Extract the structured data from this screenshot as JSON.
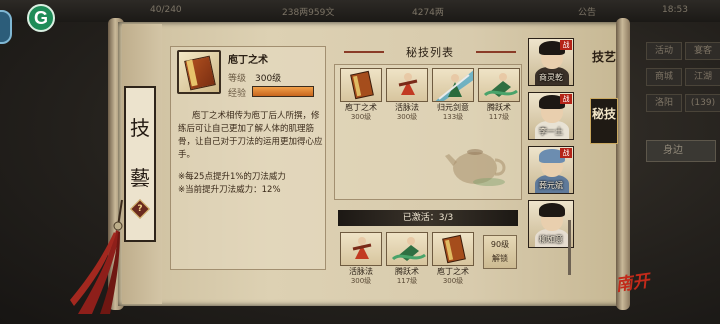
{
  "hud": {
    "stamina": "40/240",
    "coins": "238两959文",
    "gold": "4274两",
    "notice": "公告",
    "time": "18:53",
    "logo_letter": "G"
  },
  "right_menu": [
    "活动",
    "宴客",
    "商城",
    "江湖",
    "洛阳",
    "(139)"
  ],
  "right_button": "身边",
  "scroll_title": [
    "技",
    "藝"
  ],
  "help_glyph": "?",
  "selected_skill": {
    "name": "庖丁之术",
    "level_label": "等级",
    "level": "300级",
    "exp_label": "经验",
    "exp_fraction": 1.0,
    "description": "庖丁之术相传为庖丁后人所撰，修练后可让自己更加了解人体的肌理筋骨，让自己对于刀法的运用更加得心应手。",
    "bonus_1": "※每25点提升1%的刀法威力",
    "bonus_2": "※当前提升刀法威力：12%"
  },
  "skill_list": {
    "title": "秘技列表",
    "items": [
      {
        "name": "庖丁之术",
        "level": "300级",
        "icon": "book-icon"
      },
      {
        "name": "活脉法",
        "level": "300级",
        "icon": "martial-figure-icon"
      },
      {
        "name": "归元剑意",
        "level": "133级",
        "icon": "sword-figure-icon"
      },
      {
        "name": "腾跃术",
        "level": "117级",
        "icon": "leap-figure-icon"
      }
    ]
  },
  "activated": {
    "title": "已激活：3/3",
    "items": [
      {
        "name": "活脉法",
        "level": "300级"
      },
      {
        "name": "腾跃术",
        "level": "117级"
      },
      {
        "name": "庖丁之术",
        "level": "300级"
      }
    ],
    "unlock_line1": "90级",
    "unlock_line2": "解锁"
  },
  "characters": [
    {
      "name": "商灵乾",
      "badge": "战"
    },
    {
      "name": "李一土",
      "badge": "战"
    },
    {
      "name": "葬元斌",
      "badge": "战"
    },
    {
      "name": "柳如意",
      "badge": ""
    }
  ],
  "tabs": [
    {
      "label": "技艺",
      "active": false
    },
    {
      "label": "秘技",
      "active": true
    }
  ],
  "seal_text": "南开"
}
